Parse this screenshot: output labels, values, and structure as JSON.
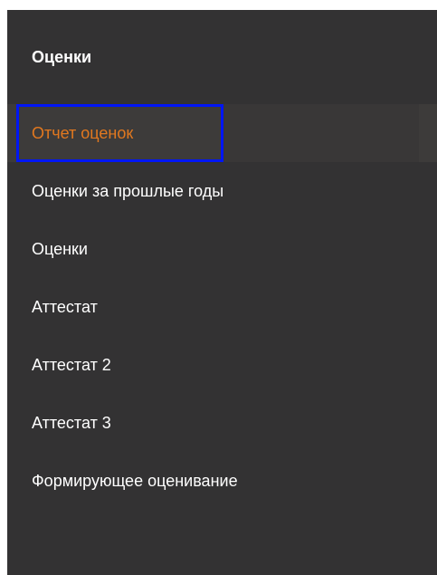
{
  "section": {
    "title": "Оценки"
  },
  "menu": {
    "items": [
      {
        "label": "Отчет оценок",
        "active": true
      },
      {
        "label": "Оценки за прошлые годы",
        "active": false
      },
      {
        "label": "Оценки",
        "active": false
      },
      {
        "label": "Аттестат",
        "active": false
      },
      {
        "label": "Аттестат 2",
        "active": false
      },
      {
        "label": "Аттестат 3",
        "active": false
      },
      {
        "label": "Формирующее оценивание",
        "active": false
      }
    ]
  },
  "colors": {
    "panel_background": "#333233",
    "active_text": "#e2781f",
    "text": "#ffffff",
    "focus_ring": "#0016f5"
  }
}
